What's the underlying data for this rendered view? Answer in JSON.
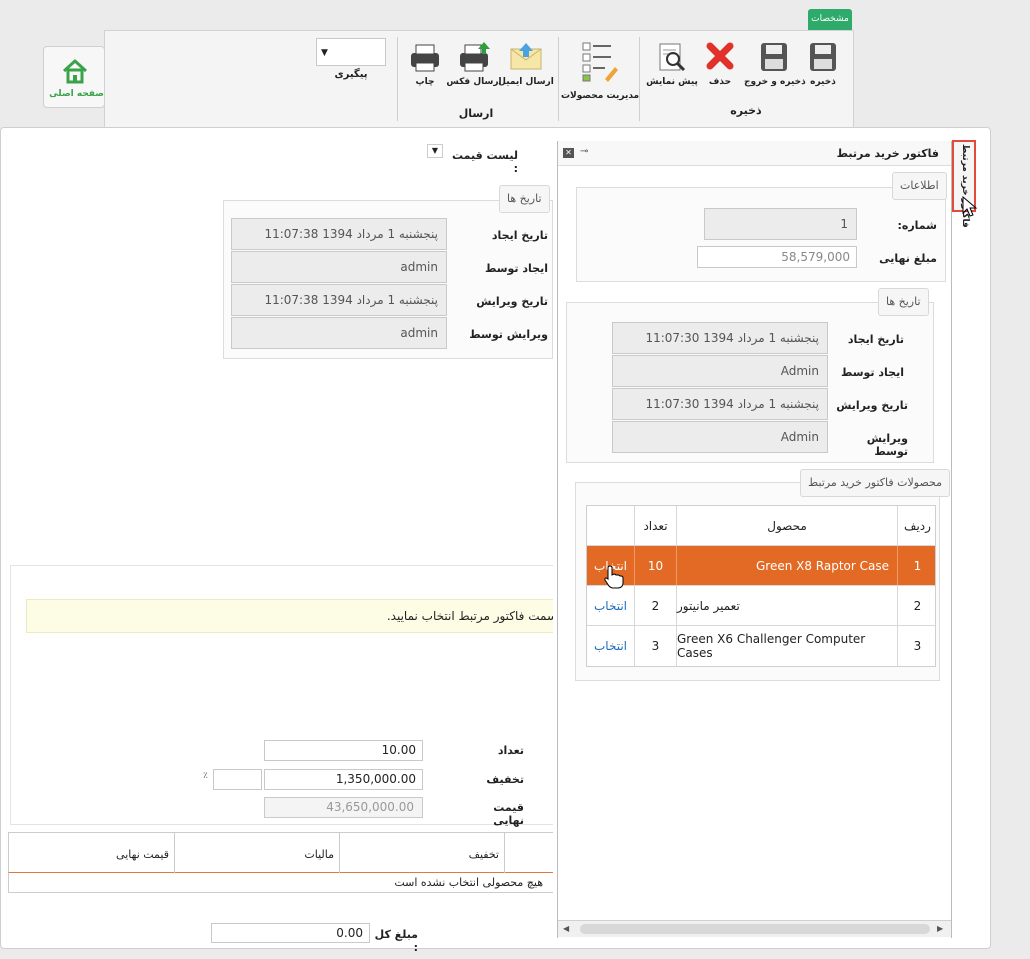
{
  "home": {
    "label": "صفحه اصلی",
    "icon": "home-icon"
  },
  "ribbon": {
    "tab_label": "مشخصات",
    "save_group_label": "ذخیره",
    "send_group_label": "ارسال",
    "buttons": {
      "save": "ذخیره",
      "save_exit": "ذخیره و خروج",
      "delete": "حذف",
      "preview": "پیش نمایش",
      "manage_products": "مدیریت محصولات",
      "send_email": "ارسال ایمیل",
      "send_fax": "ارسال فکس",
      "print": "چاپ"
    },
    "followup_label": "پیگیری",
    "followup_value": ""
  },
  "left": {
    "price_list_label": "لیست قیمت :",
    "dates_legend": "تاریخ ها",
    "created_date_label": "تاریخ ایجاد",
    "created_date_value": "پنجشنبه 1 مرداد 1394 11:07:38",
    "created_by_label": "ایجاد توسط",
    "created_by_value": "admin",
    "edited_date_label": "تاریخ ویرایش",
    "edited_date_value": "پنجشنبه 1 مرداد 1394 11:07:38",
    "edited_by_label": "ویرایش توسط",
    "edited_by_value": "admin",
    "notice": "سمت فاکتور مرتبط انتخاب نمایید.",
    "qty_label": "تعداد",
    "qty_value": "10.00",
    "discount_label": "تخفیف",
    "discount_value": "1,350,000.00",
    "discount_pct_value": "",
    "pct_symbol": "٪",
    "final_price_label": "قیمت نهایی",
    "final_price_value": "43,650,000.00",
    "grid_headers": [
      "تخفیف",
      "مالیات",
      "قیمت نهایی"
    ],
    "grid_empty": "هیچ محصولی انتخاب نشده است",
    "total_label": "مبلغ کل :",
    "total_value": "0.00"
  },
  "right": {
    "title": "فاکتور خرید مرتبط",
    "info_legend": "اطلاعات",
    "number_label": "شماره:",
    "number_value": "1",
    "final_amount_label": "مبلغ نهایی",
    "final_amount_value": "58,579,000",
    "dates_legend": "تاریخ ها",
    "created_date_label": "تاریخ ایجاد",
    "created_date_value": "پنجشنبه 1 مرداد 1394 11:07:30",
    "created_by_label": "ایجاد توسط",
    "created_by_value": "Admin",
    "edited_date_label": "تاریخ ویرایش",
    "edited_date_value": "پنجشنبه 1 مرداد 1394 11:07:30",
    "edited_by_label": "ویرایش توسط",
    "edited_by_value": "Admin",
    "products_legend": "محصولات فاکتور خرید مرتبط",
    "table_headers": {
      "row": "ردیف",
      "product": "محصول",
      "qty": "تعداد"
    },
    "rows": [
      {
        "row": "1",
        "product": "Green X8 Raptor Case",
        "qty": "10",
        "action": "انتخاب"
      },
      {
        "row": "2",
        "product": "تعمیر مانیتور",
        "qty": "2",
        "action": "انتخاب"
      },
      {
        "row": "3",
        "product": "Green X6 Challenger Computer Cases",
        "qty": "3",
        "action": "انتخاب"
      }
    ]
  },
  "side_tab": "فاکتور خرید مرتبط",
  "colors": {
    "accent": "#2fbf71",
    "selected_row": "#e36a24",
    "link": "#1e6bbd",
    "side_tab_border": "#e04b3c"
  }
}
